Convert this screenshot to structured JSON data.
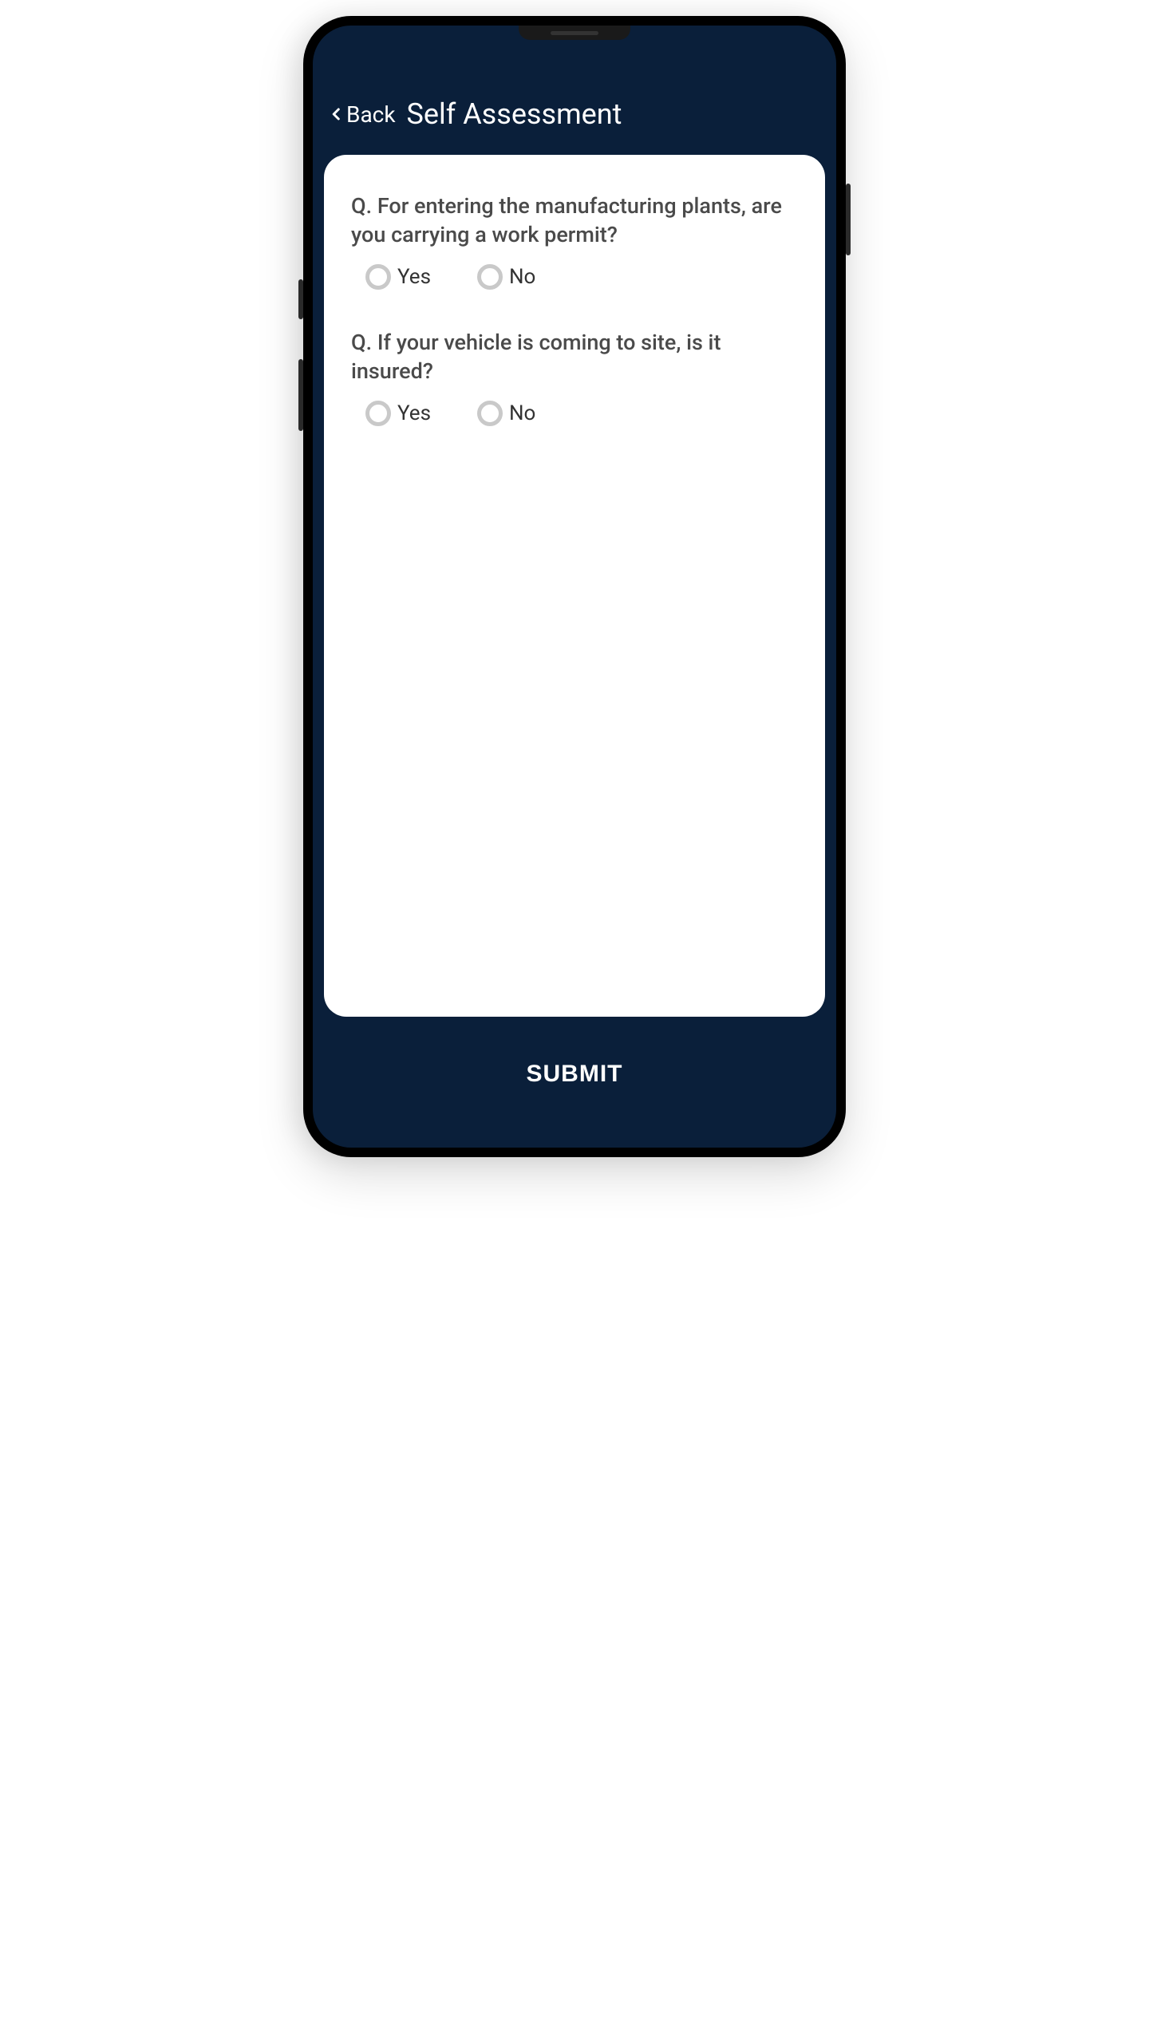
{
  "header": {
    "back_label": "Back",
    "title": "Self Assessment"
  },
  "questions": [
    {
      "prompt": "Q. For entering the manufacturing plants, are you carrying a work permit?",
      "options": {
        "yes": "Yes",
        "no": "No"
      }
    },
    {
      "prompt": "Q. If your vehicle is coming to site, is it insured?",
      "options": {
        "yes": "Yes",
        "no": "No"
      }
    }
  ],
  "footer": {
    "submit_label": "SUBMIT"
  }
}
